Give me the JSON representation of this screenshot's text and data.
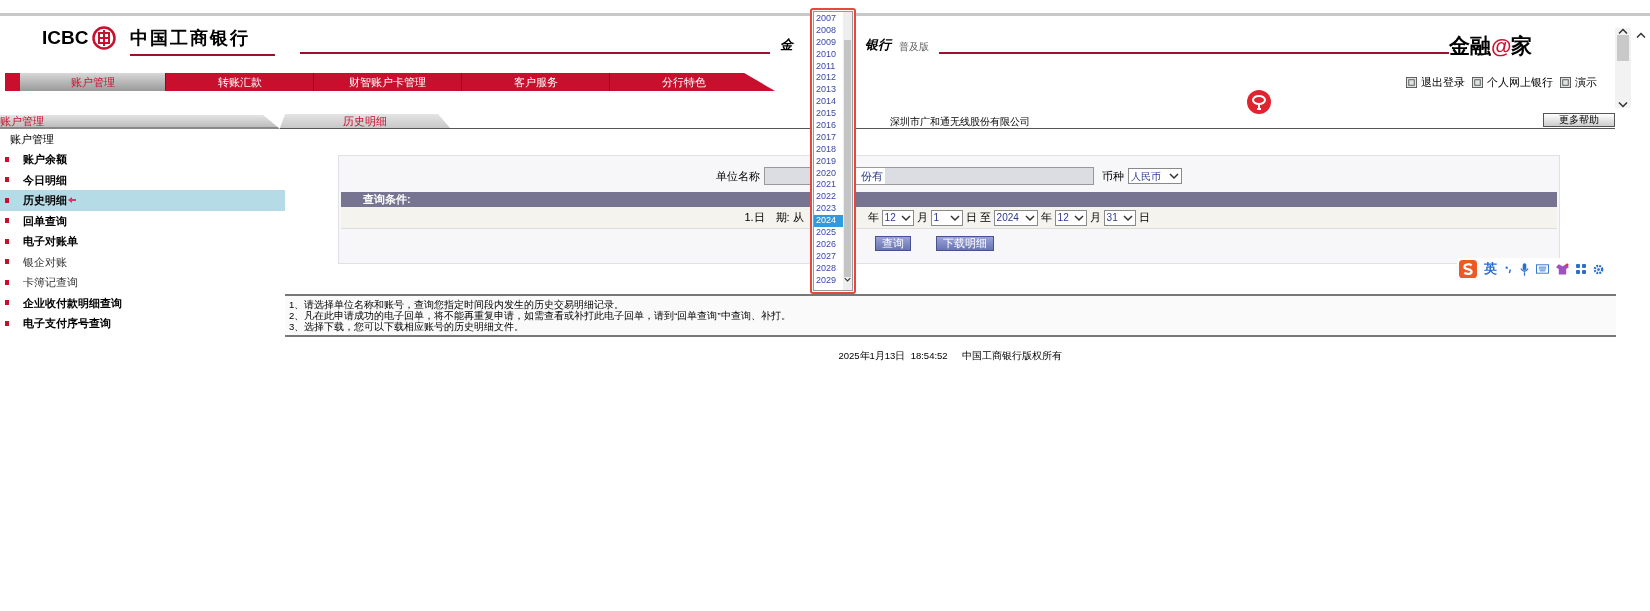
{
  "header": {
    "logo_text": "ICBC",
    "bank_name": "中国工商银行",
    "center_title_parts": [
      "金",
      "银行"
    ],
    "edition": "普及版",
    "brand": {
      "before": "金融",
      "mark": "@",
      "after": "家"
    }
  },
  "nav_tabs": [
    {
      "label": "账户管理",
      "selected": true
    },
    {
      "label": "转账汇款",
      "selected": false
    },
    {
      "label": "财智账户卡管理",
      "selected": false
    },
    {
      "label": "客户服务",
      "selected": false
    },
    {
      "label": "分行特色",
      "selected": false
    }
  ],
  "top_links": [
    "退出登录",
    "个人网上银行",
    "演示"
  ],
  "section_tabs": [
    "账户管理",
    "历史明细"
  ],
  "company": "深圳市广和通无线股份有限公司",
  "help_button": "更多帮助",
  "sidebar": {
    "title": "账户管理",
    "items": [
      {
        "label": "账户余额",
        "bold": true,
        "selected": false
      },
      {
        "label": "今日明细",
        "bold": true,
        "selected": false
      },
      {
        "label": "历史明细",
        "bold": true,
        "selected": true
      },
      {
        "label": "回单查询",
        "bold": true,
        "selected": false
      },
      {
        "label": "电子对账单",
        "bold": true,
        "selected": false
      },
      {
        "label": "银企对账",
        "bold": false,
        "selected": false
      },
      {
        "label": "卡簿记查询",
        "bold": false,
        "selected": false
      },
      {
        "label": "企业收付款明细查询",
        "bold": true,
        "selected": false
      },
      {
        "label": "电子支付序号查询",
        "bold": true,
        "selected": false
      }
    ]
  },
  "form": {
    "unit_label": "单位名称",
    "unit_value": "份有",
    "currency_label": "币种",
    "currency_value": "人民币",
    "section_title": "查询条件:",
    "date_row": [
      {
        "kind": "label",
        "text": "1.日　期:"
      },
      {
        "kind": "label",
        "text": "从"
      },
      {
        "kind": "covered"
      },
      {
        "kind": "label",
        "text": "年"
      },
      {
        "kind": "select",
        "value": "12"
      },
      {
        "kind": "label",
        "text": "月"
      },
      {
        "kind": "select",
        "value": "1"
      },
      {
        "kind": "label",
        "text": "日"
      },
      {
        "kind": "label",
        "text": "至"
      },
      {
        "kind": "select",
        "value": "2024"
      },
      {
        "kind": "label",
        "text": "年"
      },
      {
        "kind": "select",
        "value": "12"
      },
      {
        "kind": "label",
        "text": "月"
      },
      {
        "kind": "select",
        "value": "31"
      },
      {
        "kind": "label",
        "text": "日"
      }
    ],
    "buttons": [
      "查询",
      "下载明细"
    ]
  },
  "notes": [
    "1、请选择单位名称和账号，查询您指定时间段内发生的历史交易明细记录。",
    "2、凡在此申请成功的电子回单，将不能再重复申请，如需查看或补打此电子回单，请到“回单查询”中查询、补打。",
    "3、选择下载，您可以下载相应账号的历史明细文件。"
  ],
  "footer": {
    "timestamp": "2025年1月13日  18:54:52",
    "copyright": "中国工商银行版权所有"
  },
  "year_dropdown": {
    "options": [
      {
        "label": "2007",
        "selected": false
      },
      {
        "label": "2008",
        "selected": false
      },
      {
        "label": "2009",
        "selected": false
      },
      {
        "label": "2010",
        "selected": false
      },
      {
        "label": "2011",
        "selected": false
      },
      {
        "label": "2012",
        "selected": false
      },
      {
        "label": "2013",
        "selected": false
      },
      {
        "label": "2014",
        "selected": false
      },
      {
        "label": "2015",
        "selected": false
      },
      {
        "label": "2016",
        "selected": false
      },
      {
        "label": "2017",
        "selected": false
      },
      {
        "label": "2018",
        "selected": false
      },
      {
        "label": "2019",
        "selected": false
      },
      {
        "label": "2020",
        "selected": false
      },
      {
        "label": "2021",
        "selected": false
      },
      {
        "label": "2022",
        "selected": false
      },
      {
        "label": "2023",
        "selected": false
      },
      {
        "label": "2024",
        "selected": true
      },
      {
        "label": "2025",
        "selected": false
      },
      {
        "label": "2026",
        "selected": false
      },
      {
        "label": "2027",
        "selected": false
      },
      {
        "label": "2028",
        "selected": false
      },
      {
        "label": "2029",
        "selected": false
      }
    ]
  },
  "ime_toolbar": {
    "mode": "英"
  }
}
